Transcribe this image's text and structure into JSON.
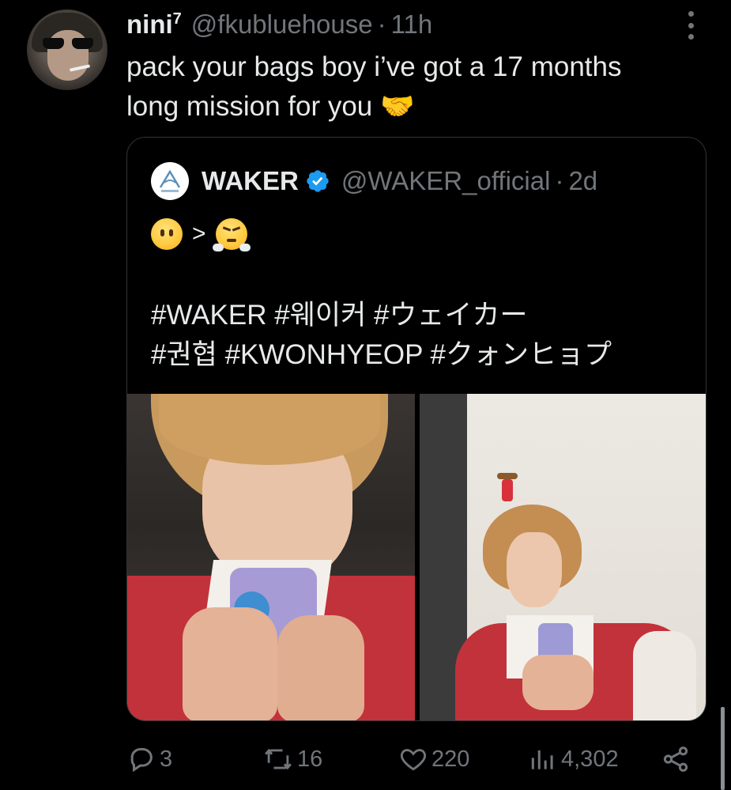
{
  "tweet": {
    "display_name": "nini",
    "display_name_sup": "7",
    "handle": "@fkubluehouse",
    "separator": "·",
    "time": "11h",
    "text": "pack your bags boy i’ve got a 17 months\nlong mission for you 🤝"
  },
  "quoted_tweet": {
    "display_name": "WAKER",
    "handle": "@WAKER_official",
    "separator": "·",
    "time": "2d",
    "emoji_comparator": ">",
    "hashtags": "#WAKER #웨이커 #ウェイカー\n#권협 #KWONHYEOP #クォンヒョプ"
  },
  "actions": {
    "replies": "3",
    "retweets": "16",
    "likes": "220",
    "views": "4,302"
  },
  "icons": {
    "more": "more-vertical-icon",
    "verified": "verified-badge-icon",
    "reply": "reply-icon",
    "retweet": "retweet-icon",
    "like": "heart-icon",
    "views": "views-chart-icon",
    "share": "share-icon"
  },
  "colors": {
    "background": "#000000",
    "text": "#e7e9ea",
    "muted": "#71767b",
    "border": "#2f3336",
    "verified": "#1d9bf0"
  }
}
